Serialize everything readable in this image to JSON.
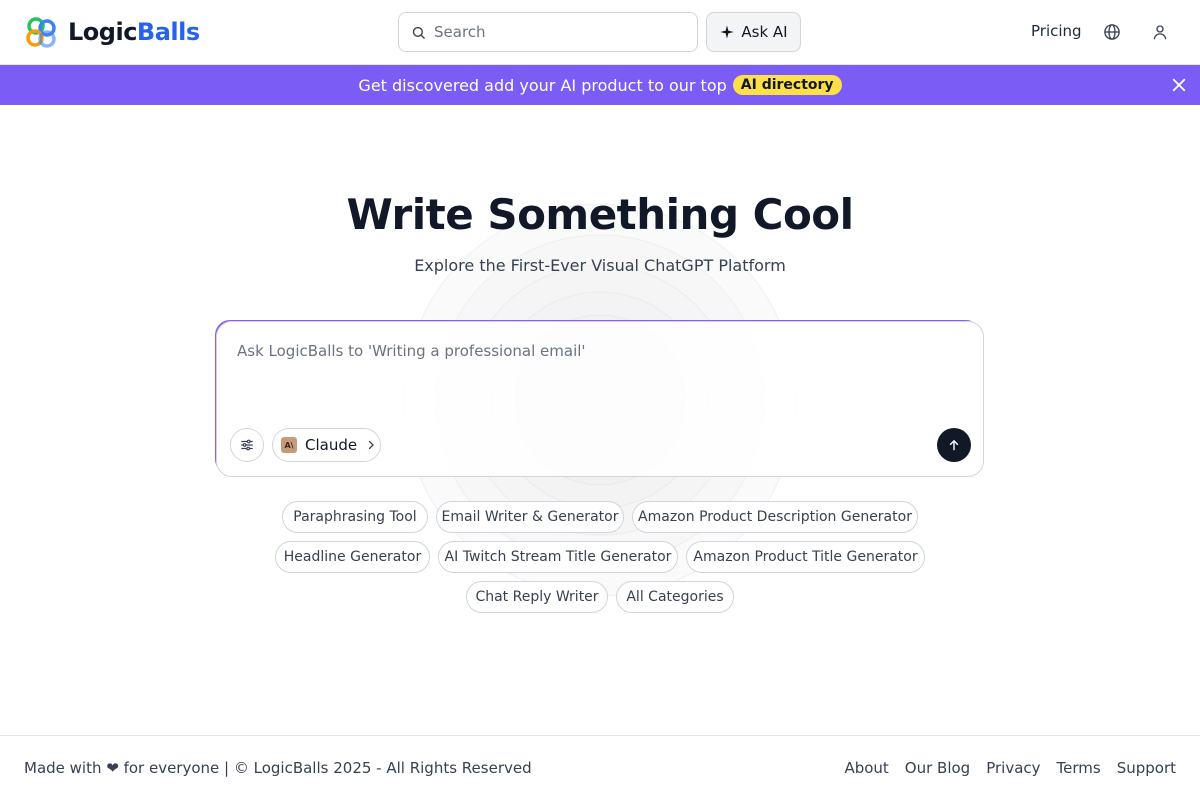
{
  "header": {
    "logo_text_a": "Logic",
    "logo_text_b": "Balls",
    "search_placeholder": "Search",
    "ask_ai_label": "Ask AI",
    "pricing_label": "Pricing"
  },
  "banner": {
    "text": "Get discovered add your AI product to our top",
    "badge": "AI directory"
  },
  "hero": {
    "title": "Write Something Cool",
    "subtitle": "Explore the First-Ever Visual ChatGPT Platform",
    "prompt_placeholder": "Ask LogicBalls to 'Writing a professional email'",
    "model_label": "Claude",
    "model_icon_text": "A\\"
  },
  "chips": [
    "Paraphrasing Tool",
    "Email Writer & Generator",
    "Amazon Product Description Generator",
    "Headline Generator",
    "AI Twitch Stream Title Generator",
    "Amazon Product Title Generator",
    "Chat Reply Writer",
    "All Categories"
  ],
  "footer": {
    "left_text": "Made with ❤ for everyone | © LogicBalls 2025 - All Rights Reserved",
    "links": [
      "About",
      "Our Blog",
      "Privacy",
      "Terms",
      "Support"
    ]
  },
  "colors": {
    "banner_bg": "#7b5cf5",
    "badge_bg": "#fde047",
    "brand_blue": "#2563eb",
    "send_button": "#111827"
  }
}
